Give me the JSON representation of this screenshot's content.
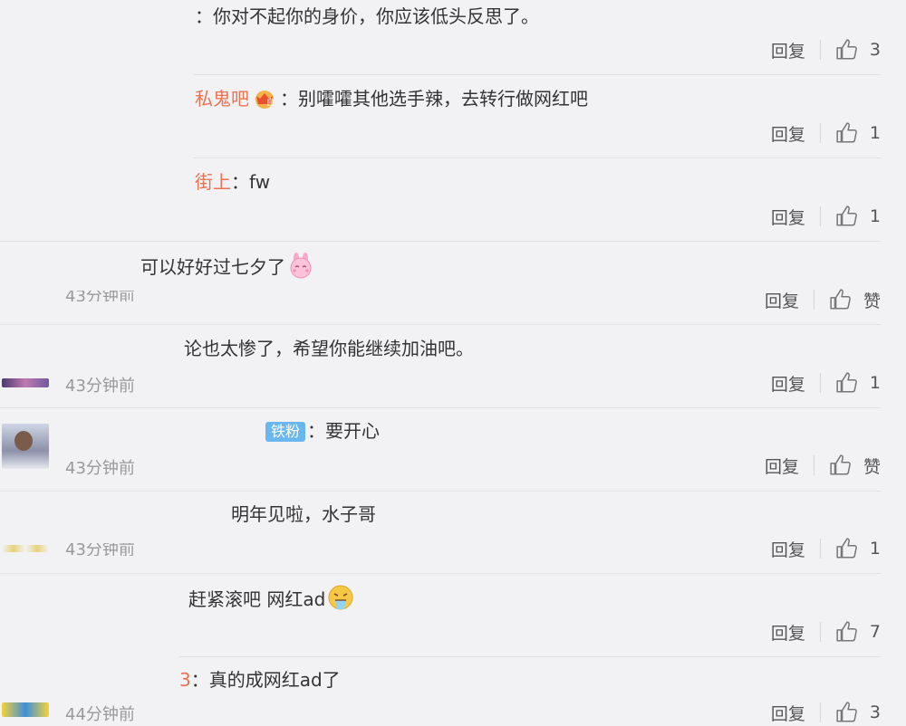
{
  "comments": [
    {
      "text": "：你对不起你的身价，你应该低头反思了。",
      "reply": "回复",
      "likes": "3"
    },
    {
      "author": "私鬼吧",
      "text": "：别嚯嚯其他选手辣，去转行做网红吧",
      "reply": "回复",
      "likes": "1"
    },
    {
      "author": "街上",
      "text": "：fw",
      "reply": "回复",
      "likes": "1"
    },
    {
      "text": "可以好好过七夕了",
      "emoji": "pink-bunny-emoji",
      "time": "43分钟前",
      "reply": "回复",
      "likes": "赞"
    },
    {
      "text": "论也太惨了，希望你能继续加油吧。",
      "time": "43分钟前",
      "reply": "回复",
      "likes": "1"
    },
    {
      "badge": "铁粉",
      "text": "：要开心",
      "time": "43分钟前",
      "reply": "回复",
      "likes": "赞"
    },
    {
      "text": "明年见啦，水子哥",
      "time": "43分钟前",
      "reply": "回复",
      "likes": "1"
    },
    {
      "text": "赶紧滚吧 网红ad",
      "emoji": "vomit-face-emoji",
      "reply": "回复",
      "likes": "7"
    },
    {
      "author": "3",
      "text": "：真的成网红ad了",
      "time": "44分钟前",
      "reply": "回复",
      "likes": "3"
    }
  ],
  "colors": {
    "background": "#f2f2f5",
    "author": "#eb7350",
    "badge": "#6ab7f0",
    "muted": "#999999"
  }
}
